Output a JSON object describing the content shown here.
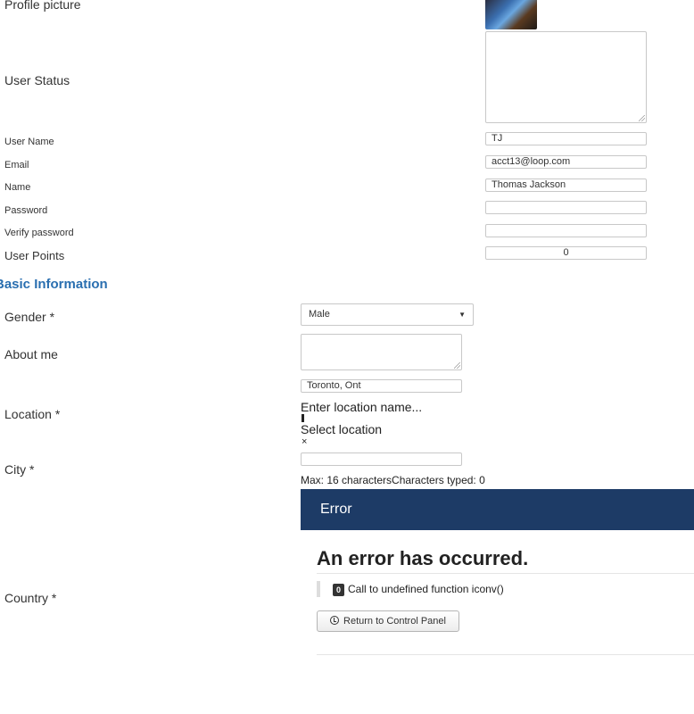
{
  "profile": {
    "picture_label": "Profile picture",
    "status_label": "User Status",
    "username_label": "User Name",
    "username_value": "TJ",
    "email_label": "Email",
    "email_value": "acct13@loop.com",
    "name_label": "Name",
    "name_value": "Thomas Jackson",
    "password_label": "Password",
    "verify_password_label": "Verify password",
    "points_label": "User Points",
    "points_value": "0"
  },
  "basic": {
    "section_title": "Basic Information",
    "gender_label": "Gender *",
    "gender_selected": "Male",
    "about_label": "About me",
    "location_label": "Location *",
    "location_value": "Toronto, Ont",
    "location_prompt": "Enter location name...",
    "select_location": "Select location",
    "clear_symbol": "×",
    "city_label": "City *",
    "char_counter": "Max: 16 charactersCharacters typed: 0",
    "country_label": "Country *"
  },
  "error": {
    "header": "Error",
    "title": "An error has occurred.",
    "code": "0",
    "message": "Call to undefined function iconv()",
    "button_label": "Return to Control Panel"
  }
}
